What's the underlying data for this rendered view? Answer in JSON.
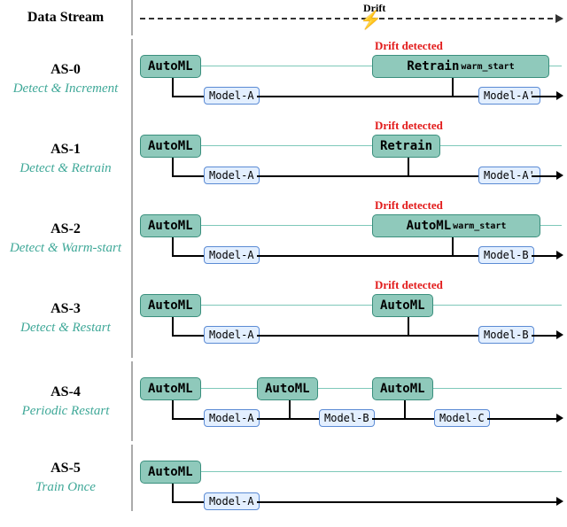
{
  "header": {
    "title": "Data Stream",
    "drift_label": "Drift"
  },
  "rows": [
    {
      "id": "as0",
      "name": "AS-0",
      "sub": "Detect & Increment",
      "drift": "Drift detected",
      "box1": "AutoML",
      "box2": "Retrain",
      "box2_sub": "warm_start",
      "model1": "Model-A",
      "model2": "Model-A'"
    },
    {
      "id": "as1",
      "name": "AS-1",
      "sub": "Detect & Retrain",
      "drift": "Drift detected",
      "box1": "AutoML",
      "box2": "Retrain",
      "model1": "Model-A",
      "model2": "Model-A'"
    },
    {
      "id": "as2",
      "name": "AS-2",
      "sub": "Detect & Warm-start",
      "drift": "Drift detected",
      "box1": "AutoML",
      "box2": "AutoML",
      "box2_sub": "warm_start",
      "model1": "Model-A",
      "model2": "Model-B"
    },
    {
      "id": "as3",
      "name": "AS-3",
      "sub": "Detect & Restart",
      "drift": "Drift detected",
      "box1": "AutoML",
      "box2": "AutoML",
      "model1": "Model-A",
      "model2": "Model-B"
    },
    {
      "id": "as4",
      "name": "AS-4",
      "sub": "Periodic Restart",
      "box1": "AutoML",
      "box2": "AutoML",
      "box3": "AutoML",
      "model1": "Model-A",
      "model2": "Model-B",
      "model3": "Model-C"
    },
    {
      "id": "as5",
      "name": "AS-5",
      "sub": "Train Once",
      "box1": "AutoML",
      "model1": "Model-A"
    }
  ]
}
